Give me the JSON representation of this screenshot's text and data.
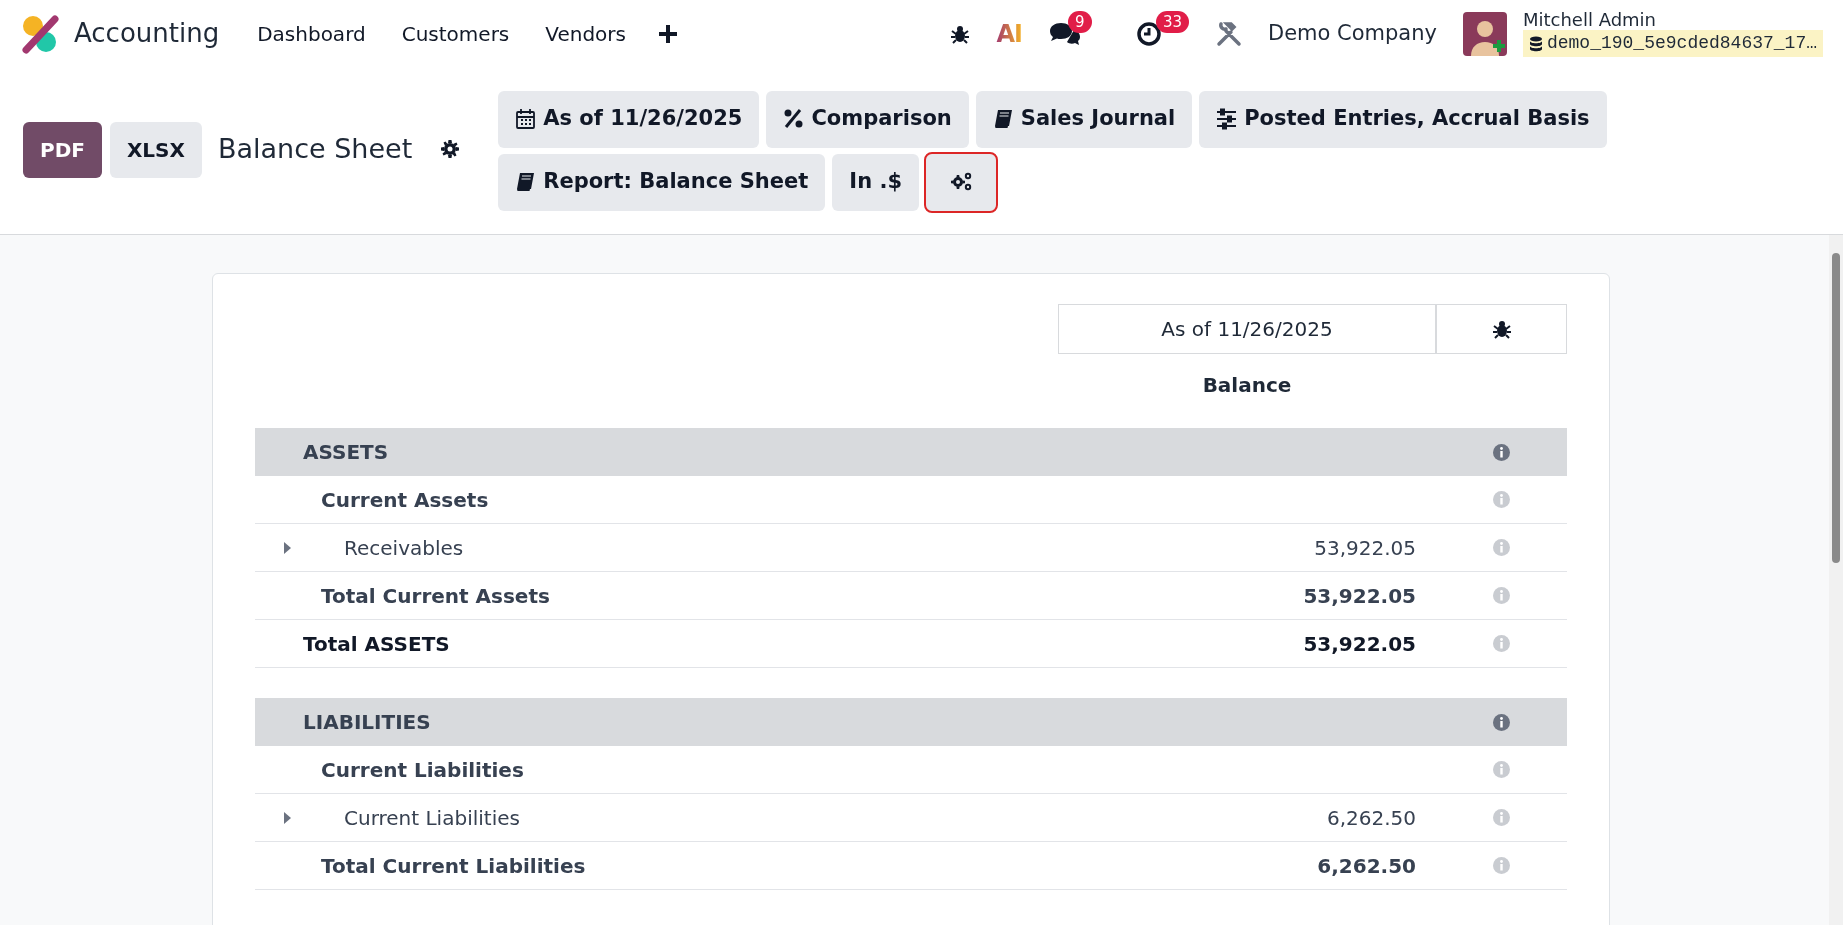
{
  "navbar": {
    "app_name": "Accounting",
    "menu": [
      {
        "label": "Dashboard"
      },
      {
        "label": "Customers"
      },
      {
        "label": "Vendors"
      }
    ],
    "systray": {
      "ai_label": "AI",
      "messages_count": "9",
      "activities_count": "33",
      "company": "Demo Company",
      "user_name": "Mitchell Admin",
      "database": "demo_190_5e9cded84637_17…"
    }
  },
  "control_panel": {
    "export_buttons": [
      {
        "label": "PDF",
        "kind": "primary"
      },
      {
        "label": "XLSX",
        "kind": "secondary"
      }
    ],
    "title": "Balance Sheet",
    "filter_rows": [
      [
        {
          "label": "As of 11/26/2025",
          "kind": "date",
          "highlighted": false
        },
        {
          "label": "Comparison",
          "kind": "comparison",
          "highlighted": false
        },
        {
          "label": "Sales Journal",
          "kind": "journal",
          "highlighted": false
        },
        {
          "label": "Posted Entries, Accrual Basis",
          "kind": "options",
          "highlighted": false
        }
      ],
      [
        {
          "label": "Report: Balance Sheet",
          "kind": "journal",
          "highlighted": false
        },
        {
          "label": "In .$",
          "kind": "text",
          "highlighted": false
        },
        {
          "kind": "settings",
          "highlighted": true
        }
      ]
    ]
  },
  "report": {
    "period_header": "As of 11/26/2025",
    "column_header": "Balance",
    "rows": [
      {
        "kind": "section",
        "name": "ASSETS"
      },
      {
        "kind": "group",
        "name": "Current Assets"
      },
      {
        "kind": "account",
        "name": "Receivables",
        "amount": "53,922.05"
      },
      {
        "kind": "subtotal",
        "name": "Total Current Assets",
        "amount": "53,922.05"
      },
      {
        "kind": "total",
        "name": "Total ASSETS",
        "amount": "53,922.05"
      },
      {
        "kind": "spacer"
      },
      {
        "kind": "section",
        "name": "LIABILITIES"
      },
      {
        "kind": "group",
        "name": "Current Liabilities"
      },
      {
        "kind": "account",
        "name": "Current Liabilities",
        "amount": "6,262.50"
      },
      {
        "kind": "subtotal",
        "name": "Total Current Liabilities",
        "amount": "6,262.50"
      }
    ]
  }
}
